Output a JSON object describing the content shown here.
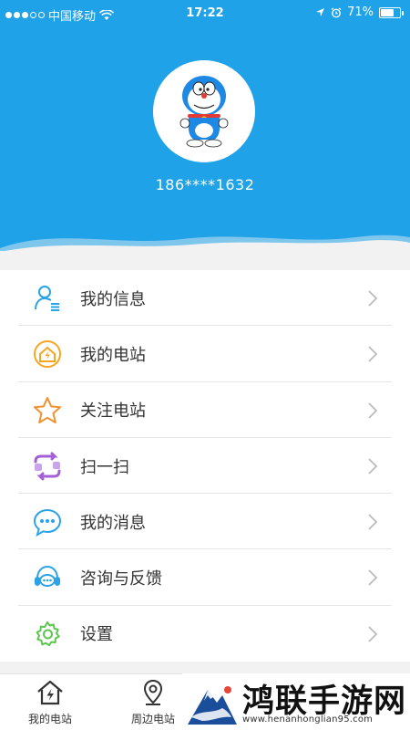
{
  "status_bar": {
    "carrier": "中国移动",
    "time": "17:22",
    "battery": "71%",
    "battery_level": 0.71
  },
  "profile": {
    "phone": "186****1632"
  },
  "menu": [
    {
      "label": "我的信息",
      "icon": "user-info-icon"
    },
    {
      "label": "我的电站",
      "icon": "power-station-icon"
    },
    {
      "label": "关注电站",
      "icon": "star-icon"
    },
    {
      "label": "扫一扫",
      "icon": "scan-icon"
    },
    {
      "label": "我的消息",
      "icon": "message-icon"
    },
    {
      "label": "咨询与反馈",
      "icon": "headset-icon"
    },
    {
      "label": "设置",
      "icon": "gear-icon"
    }
  ],
  "tabbar": [
    {
      "label": "我的电站",
      "icon": "home-power-icon"
    },
    {
      "label": "周边电站",
      "icon": "location-pin-icon"
    }
  ],
  "watermark": {
    "title": "鸿联手游网",
    "url": "www.henanhonglian95.com"
  },
  "colors": {
    "header": "#1fa2e8",
    "accent_orange": "#f5a623",
    "accent_purple": "#9b59d0",
    "accent_green": "#5cc74f"
  }
}
